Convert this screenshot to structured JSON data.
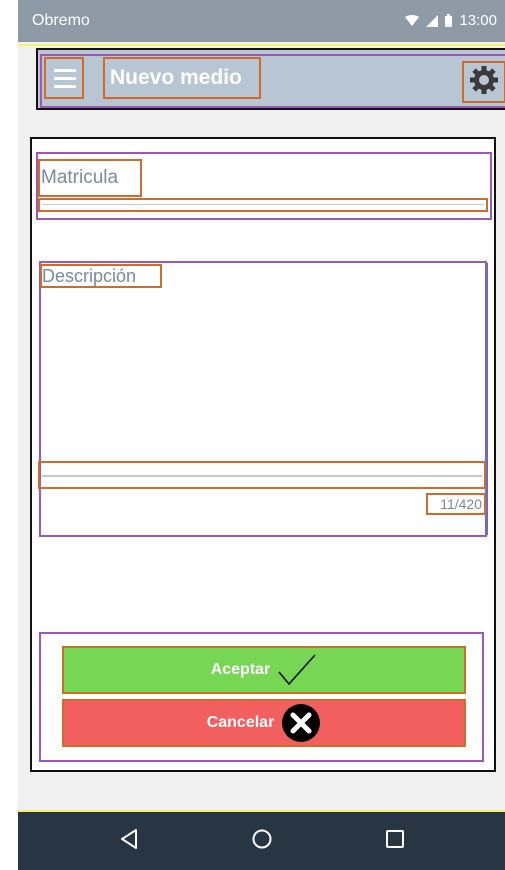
{
  "status_bar": {
    "carrier": "Obremo",
    "time": "13:00"
  },
  "app_bar": {
    "title": "Nuevo medio"
  },
  "form": {
    "matricula_label": "Matricula",
    "descripcion_label": "Descripción",
    "descripcion_counter": "11/420"
  },
  "buttons": {
    "accept": "Aceptar",
    "cancel": "Cancelar"
  },
  "colors": {
    "appbar": "#b8c6d4",
    "accept": "#77d654",
    "cancel": "#f25f5f",
    "navbar": "#283543"
  },
  "icons": {
    "menu": "menu-icon",
    "settings": "gear-icon",
    "check": "check-icon",
    "cancel": "close-circle-icon",
    "back": "back-icon",
    "home": "home-icon",
    "recents": "recents-icon"
  }
}
